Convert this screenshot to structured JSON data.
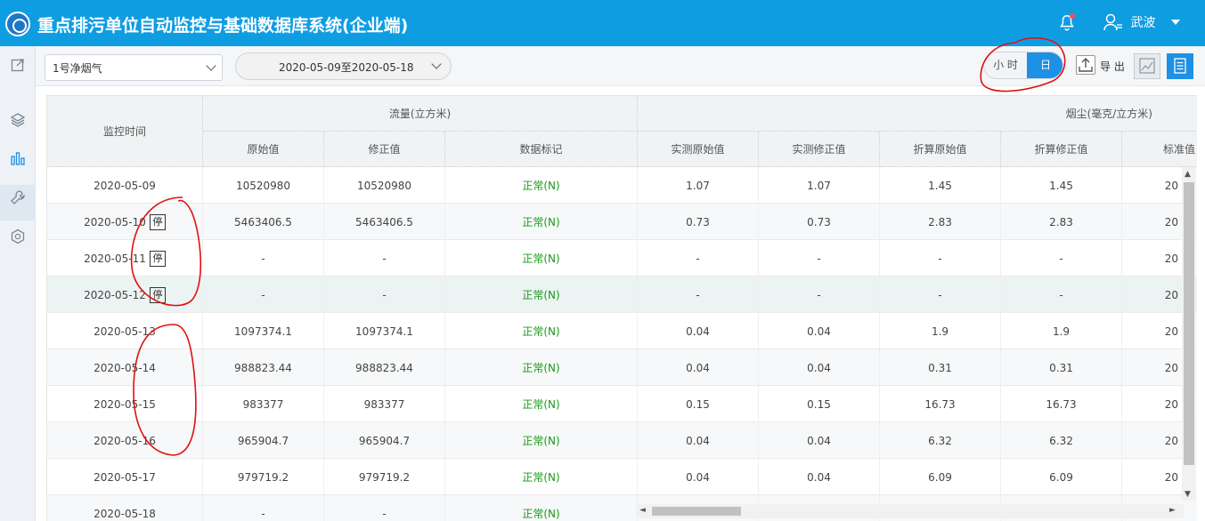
{
  "app": {
    "title": "重点排污单位自动监控与基础数据库系统(企业端)",
    "user_name": "武波",
    "colors": {
      "header": "#0f9de2",
      "accent": "#1e90e6",
      "status_ok": "#1a9a1a"
    }
  },
  "toolbar": {
    "outlet_select": "1号净烟气",
    "date_range": "2020-05-09至2020-05-18",
    "toggle_hour": "小 时",
    "toggle_day": "日",
    "export_label": "导 出"
  },
  "sidebar": {
    "icons": [
      "external-link-icon",
      "layers-icon",
      "bar-chart-icon",
      "wrench-icon",
      "hexagon-settings-icon"
    ]
  },
  "table": {
    "headers": {
      "time": "监控时间",
      "flow_group": "流量(立方米)",
      "dust_group": "烟尘(毫克/立方米)",
      "cols": [
        "原始值",
        "修正值",
        "数据标记",
        "实测原始值",
        "实测修正值",
        "折算原始值",
        "折算修正值",
        "标准值"
      ]
    },
    "stop_label": "停",
    "rows": [
      {
        "time": "2020-05-09",
        "stop": false,
        "v": [
          "10520980",
          "10520980",
          "正常(N)",
          "1.07",
          "1.07",
          "1.45",
          "1.45",
          "20"
        ]
      },
      {
        "time": "2020-05-10",
        "stop": true,
        "v": [
          "5463406.5",
          "5463406.5",
          "正常(N)",
          "0.73",
          "0.73",
          "2.83",
          "2.83",
          "20"
        ]
      },
      {
        "time": "2020-05-11",
        "stop": true,
        "v": [
          "-",
          "-",
          "正常(N)",
          "-",
          "-",
          "-",
          "-",
          "20"
        ]
      },
      {
        "time": "2020-05-12",
        "stop": true,
        "v": [
          "-",
          "-",
          "正常(N)",
          "-",
          "-",
          "-",
          "-",
          "20"
        ]
      },
      {
        "time": "2020-05-13",
        "stop": false,
        "v": [
          "1097374.1",
          "1097374.1",
          "正常(N)",
          "0.04",
          "0.04",
          "1.9",
          "1.9",
          "20"
        ]
      },
      {
        "time": "2020-05-14",
        "stop": false,
        "v": [
          "988823.44",
          "988823.44",
          "正常(N)",
          "0.04",
          "0.04",
          "0.31",
          "0.31",
          "20"
        ]
      },
      {
        "time": "2020-05-15",
        "stop": false,
        "v": [
          "983377",
          "983377",
          "正常(N)",
          "0.15",
          "0.15",
          "16.73",
          "16.73",
          "20"
        ]
      },
      {
        "time": "2020-05-16",
        "stop": false,
        "v": [
          "965904.7",
          "965904.7",
          "正常(N)",
          "0.04",
          "0.04",
          "6.32",
          "6.32",
          "20"
        ]
      },
      {
        "time": "2020-05-17",
        "stop": false,
        "v": [
          "979719.2",
          "979719.2",
          "正常(N)",
          "0.04",
          "0.04",
          "6.09",
          "6.09",
          "20"
        ]
      },
      {
        "time": "2020-05-18",
        "stop": false,
        "v": [
          "-",
          "-",
          "正常(N)",
          "",
          "",
          "",
          "",
          ""
        ]
      }
    ]
  }
}
